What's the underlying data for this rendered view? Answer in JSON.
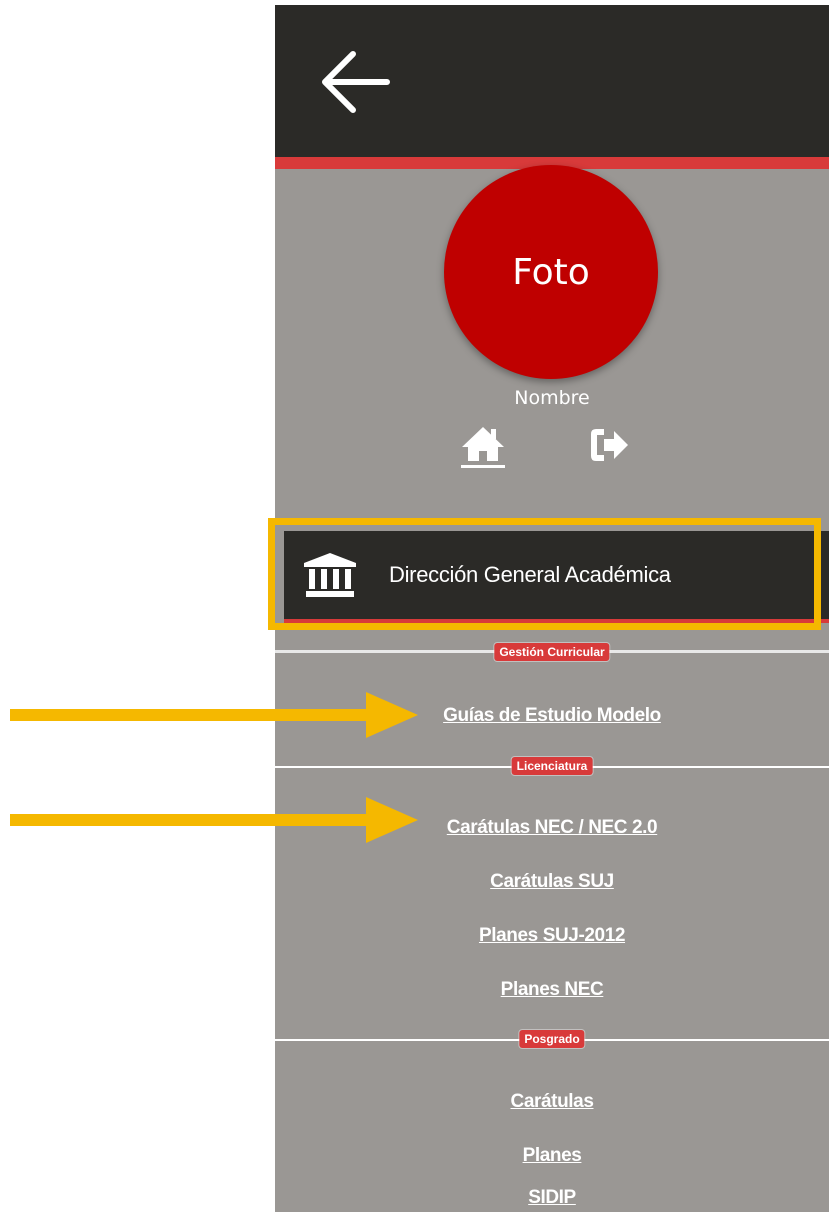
{
  "avatar": {
    "label": "Foto"
  },
  "user": {
    "name": "Nombre"
  },
  "icons": {
    "back": "arrow-left-icon",
    "home": "home-icon",
    "logout": "sign-out-icon",
    "institution": "institution-icon"
  },
  "section": {
    "title": "Dirección General Académica"
  },
  "categories": {
    "gestion": "Gestión Curricular",
    "licenciatura": "Licenciatura",
    "posgrado": "Posgrado"
  },
  "links": {
    "guias": "Guías de Estudio Modelo",
    "caratulas_nec": "Carátulas NEC / NEC 2.0",
    "caratulas_suj": "Carátulas SUJ",
    "planes_suj": "Planes SUJ-2012",
    "planes_nec": "Planes NEC",
    "caratulas": "Carátulas",
    "planes": "Planes",
    "sidip": "SIDIP"
  },
  "colors": {
    "panel_bg": "#9a9794",
    "dark_bar": "#2b2a27",
    "accent_red": "#d83a3a",
    "avatar_red": "#bf0000",
    "highlight_yellow": "#f5b800"
  }
}
